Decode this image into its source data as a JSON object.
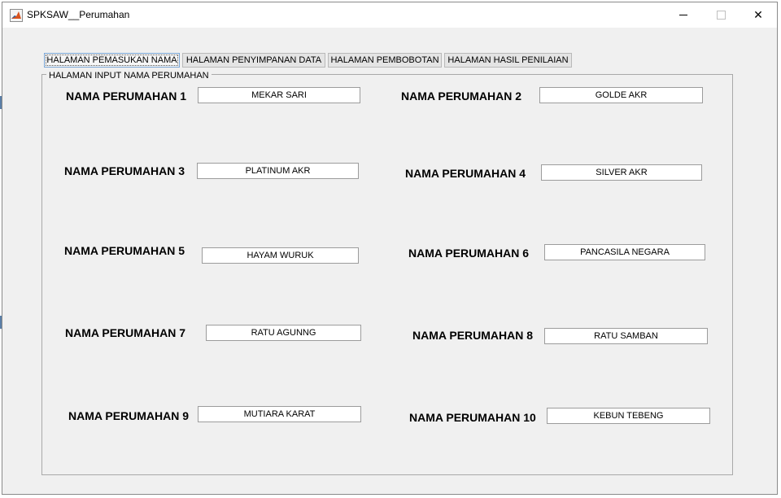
{
  "window": {
    "title": "SPKSAW__Perumahan",
    "minimize_icon": "minimize-icon",
    "maximize_icon": "maximize-icon",
    "close_icon": "close-icon",
    "close_glyph": "✕"
  },
  "tabs": [
    {
      "label": "HALAMAN PEMASUKAN NAMA",
      "active": true
    },
    {
      "label": "HALAMAN PENYIMPANAN DATA",
      "active": false
    },
    {
      "label": "HALAMAN PEMBOBOTAN",
      "active": false
    },
    {
      "label": "HALAMAN HASIL PENILAIAN",
      "active": false
    }
  ],
  "panel": {
    "title": "HALAMAN INPUT NAMA PERUMAHAN",
    "rows": [
      {
        "label": "NAMA PERUMAHAN 1",
        "value": "MEKAR SARI"
      },
      {
        "label": "NAMA PERUMAHAN 2",
        "value": "GOLDE AKR"
      },
      {
        "label": "NAMA PERUMAHAN 3",
        "value": "PLATINUM AKR"
      },
      {
        "label": "NAMA PERUMAHAN 4",
        "value": "SILVER AKR"
      },
      {
        "label": "NAMA PERUMAHAN 5",
        "value": "HAYAM WURUK"
      },
      {
        "label": "NAMA PERUMAHAN 6",
        "value": "PANCASILA NEGARA"
      },
      {
        "label": "NAMA PERUMAHAN 7",
        "value": "RATU AGUNNG"
      },
      {
        "label": "NAMA PERUMAHAN 8",
        "value": "RATU SAMBAN"
      },
      {
        "label": "NAMA PERUMAHAN 9",
        "value": "MUTIARA KARAT"
      },
      {
        "label": "NAMA PERUMAHAN 10",
        "value": "KEBUN TEBENG"
      }
    ]
  }
}
